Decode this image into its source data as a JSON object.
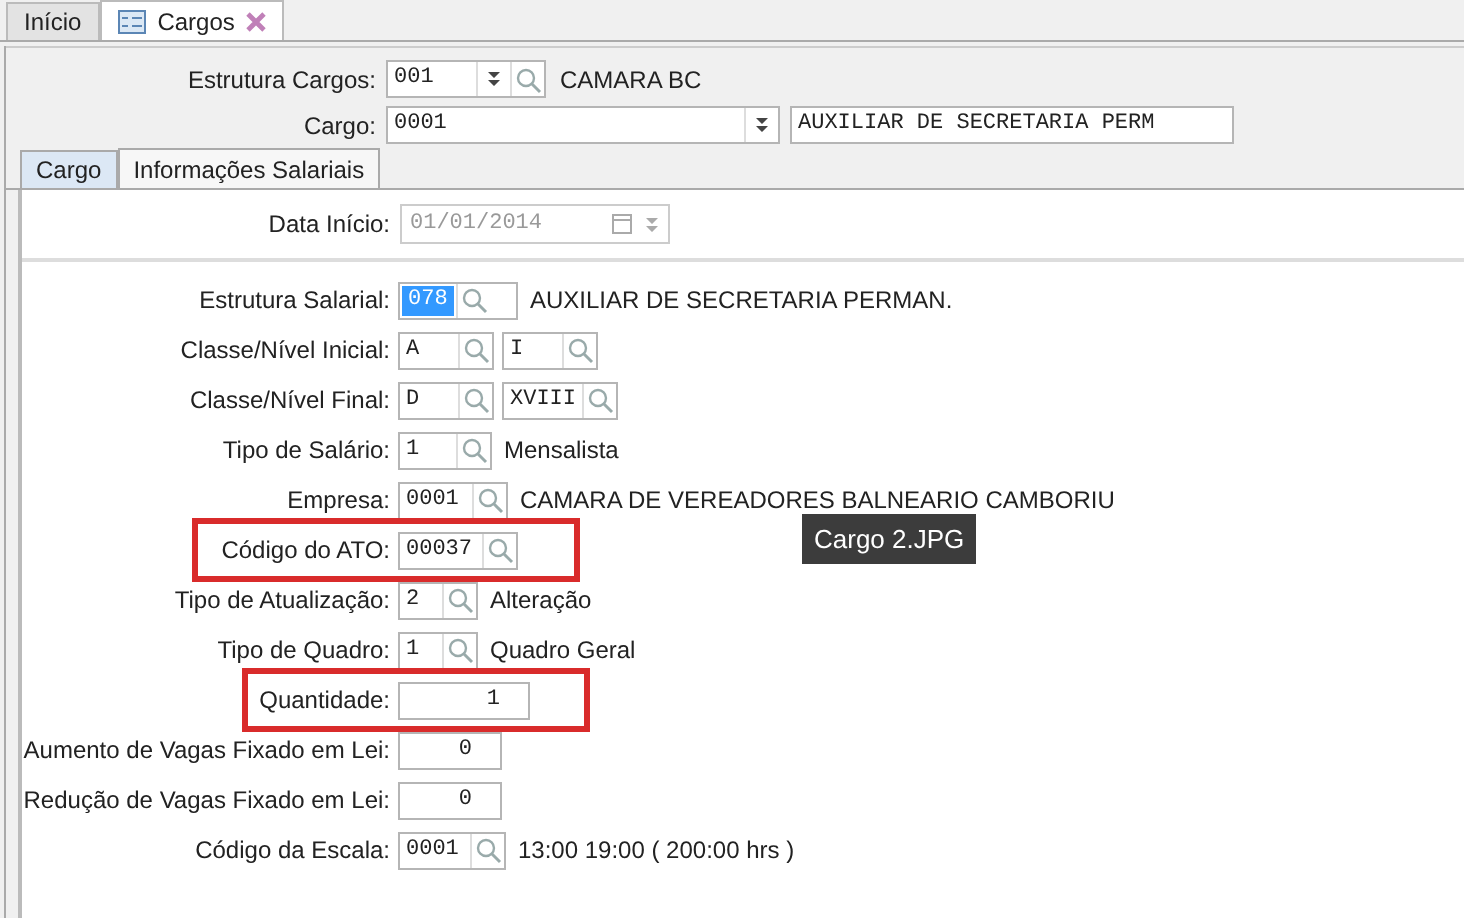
{
  "tabs": [
    {
      "label": "Início",
      "selected": false,
      "icon": false,
      "closable": false
    },
    {
      "label": "Cargos",
      "selected": true,
      "icon": true,
      "closable": true
    }
  ],
  "header": {
    "rows": [
      {
        "label": "Estrutura Cargos:",
        "inputs": [
          {
            "value": "001",
            "kind": "combo-lookup"
          }
        ],
        "description": "CAMARA BC"
      },
      {
        "label": "Cargo:",
        "inputs": [
          {
            "value": "0001",
            "kind": "combo"
          },
          {
            "value": "AUXILIAR DE SECRETARIA PERM",
            "kind": "text"
          }
        ]
      }
    ]
  },
  "subtabs": [
    {
      "label": "Cargo",
      "selected": false
    },
    {
      "label": "Informações Salariais",
      "selected": true
    }
  ],
  "date_row": {
    "label": "Data Início:",
    "value": "01/01/2014",
    "disabled": true
  },
  "rows": [
    {
      "label": "Estrutura Salarial:",
      "highlighted": false,
      "inputs": [
        {
          "value": "078",
          "kind": "lookup",
          "selected": true
        }
      ],
      "description": "AUXILIAR DE SECRETARIA PERMAN."
    },
    {
      "label": "Classe/Nível Inicial:",
      "highlighted": false,
      "inputs": [
        {
          "value": "A",
          "kind": "lookup",
          "selected": false
        },
        {
          "value": "I",
          "kind": "lookup",
          "selected": false
        }
      ]
    },
    {
      "label": "Classe/Nível Final:",
      "highlighted": false,
      "inputs": [
        {
          "value": "D",
          "kind": "lookup",
          "selected": false
        },
        {
          "value": "XVIII",
          "kind": "lookup",
          "selected": false
        }
      ]
    },
    {
      "label": "Tipo de Salário:",
      "highlighted": false,
      "inputs": [
        {
          "value": "1",
          "kind": "lookup",
          "selected": false
        }
      ],
      "description": "Mensalista"
    },
    {
      "label": "Empresa:",
      "highlighted": false,
      "inputs": [
        {
          "value": "0001",
          "kind": "lookup",
          "selected": false
        }
      ],
      "description": "CAMARA DE VEREADORES BALNEARIO CAMBORIU"
    },
    {
      "label": "Código do ATO:",
      "highlighted": true,
      "inputs": [
        {
          "value": "00037",
          "kind": "lookup",
          "selected": false
        }
      ]
    },
    {
      "label": "Tipo de Atualização:",
      "highlighted": false,
      "inputs": [
        {
          "value": "2",
          "kind": "lookup",
          "selected": false
        }
      ],
      "description": "Alteração"
    },
    {
      "label": "Tipo de Quadro:",
      "highlighted": false,
      "inputs": [
        {
          "value": "1",
          "kind": "lookup",
          "selected": false
        }
      ],
      "description": "Quadro Geral"
    },
    {
      "label": "Quantidade:",
      "highlighted": true,
      "inputs": [
        {
          "value": "1",
          "kind": "number",
          "selected": false
        }
      ]
    },
    {
      "label": "Aumento de Vagas Fixado em Lei:",
      "highlighted": false,
      "inputs": [
        {
          "value": "0",
          "kind": "number",
          "selected": false
        }
      ]
    },
    {
      "label": "Redução de Vagas Fixado em Lei:",
      "highlighted": false,
      "inputs": [
        {
          "value": "0",
          "kind": "number",
          "selected": false
        }
      ]
    },
    {
      "label": "Código da Escala:",
      "highlighted": false,
      "inputs": [
        {
          "value": "0001",
          "kind": "lookup",
          "selected": false
        }
      ],
      "description": "13:00 19:00 ( 200:00 hrs )"
    }
  ],
  "tooltip": "Cargo 2.JPG"
}
